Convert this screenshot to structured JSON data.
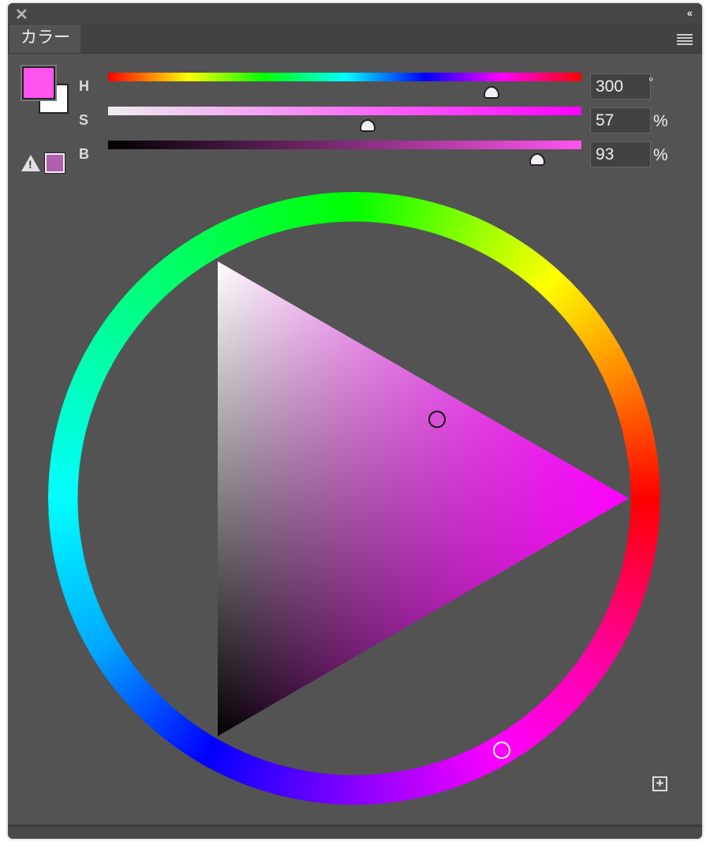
{
  "window": {
    "close_icon": "close-icon",
    "collapse_label": "‹‹"
  },
  "tab": {
    "label": "カラー"
  },
  "sliders": [
    {
      "label": "H",
      "value": "300",
      "unit": "°",
      "fraction": 0.8333
    },
    {
      "label": "S",
      "value": "57",
      "unit": "%",
      "fraction": 0.57
    },
    {
      "label": "B",
      "value": "93",
      "unit": "%",
      "fraction": 0.93
    }
  ],
  "colors": {
    "foreground": "#ee66ee",
    "background": "#ffffff",
    "gamut_warning_swatch": "#b05fae",
    "hue": "#ff00ff"
  },
  "warning_icon": "warning-icon",
  "add_button_icon": "plus-square-icon"
}
